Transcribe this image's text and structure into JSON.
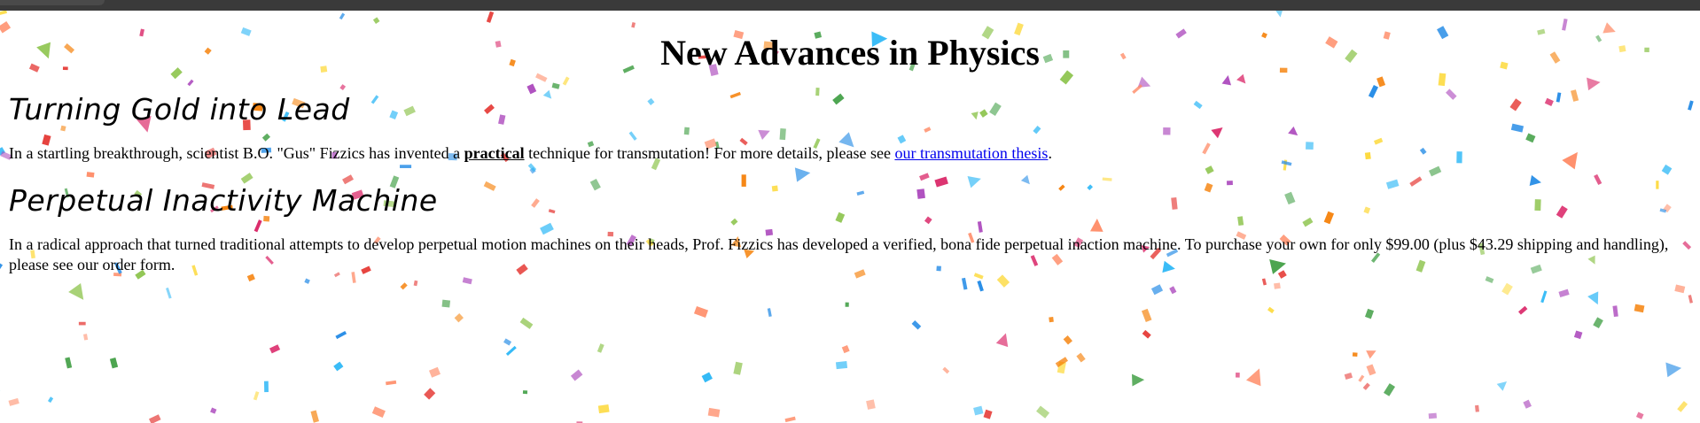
{
  "page": {
    "title": "New Advances in Physics"
  },
  "sections": [
    {
      "heading": "Turning Gold into Lead",
      "text_before": "In a startling breakthrough, scientist B.O. \"Gus\" Fizzics has invented a ",
      "emphasis": "practical",
      "text_middle": " technique for transmutation! For more details, please see ",
      "link_text": "our transmutation thesis",
      "text_after": "."
    },
    {
      "heading": "Perpetual Inactivity Machine",
      "text": "In a radical approach that turned traditional attempts to develop perpetual motion machines on their heads, Prof. Fizzics has developed a verified, bona fide perpetual inaction machine. To purchase your own for only $99.00 (plus $43.29 shipping and handling), please see our order form."
    }
  ],
  "colors": {
    "link": "#0000ee",
    "text": "#000000",
    "background": "#ffffff",
    "confetti": [
      "#e53935",
      "#f57c00",
      "#fdd835",
      "#43a047",
      "#1e88e5",
      "#d81b60",
      "#8bc34a",
      "#29b6f6",
      "#ff8a65",
      "#ab47bc"
    ]
  },
  "background_image": "confetti"
}
